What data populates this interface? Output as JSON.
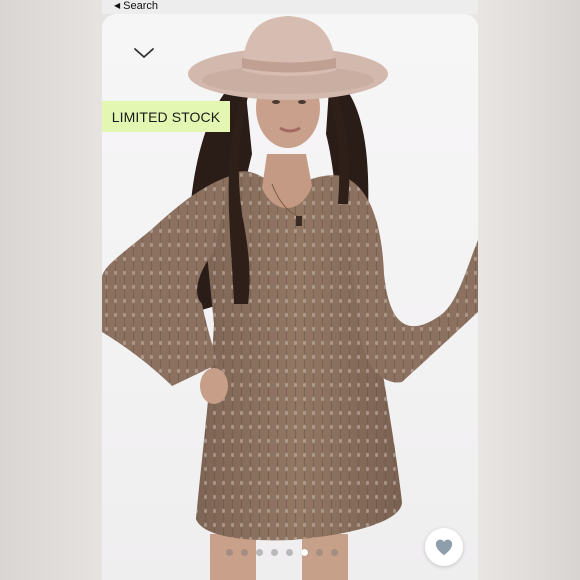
{
  "nav": {
    "back_label": "Search",
    "back_icon": "back-triangle-icon"
  },
  "product": {
    "badge": "LIMITED STOCK",
    "collapse_icon": "chevron-down-icon",
    "favorite_icon": "heart-icon",
    "carousel": {
      "total_images": 8,
      "active_index": 5
    }
  },
  "colors": {
    "badge_bg": "#e3f7b3",
    "heart": "#8f9eab",
    "dress": "#8a6f5c",
    "hat": "#d3b9ad"
  }
}
